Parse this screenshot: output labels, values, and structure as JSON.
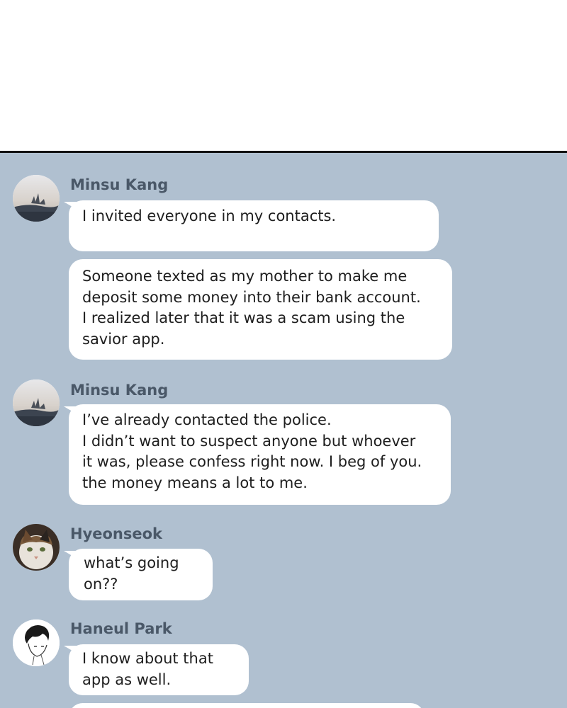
{
  "messages": [
    {
      "sender": "Minsu Kang",
      "avatar_icon": "landscape-avatar-icon",
      "bubbles": [
        "I invited everyone in my contacts.",
        "Someone texted as my mother to make me\ndeposit some money into their bank account.\nI realized later that it was a scam using the\nsavior app."
      ]
    },
    {
      "sender": "Minsu Kang",
      "avatar_icon": "landscape-avatar-icon",
      "bubbles": [
        "I’ve already contacted the police.\nI didn’t want to suspect anyone but whoever\nit was, please confess right now. I beg of you.\nthe money means a lot to me."
      ]
    },
    {
      "sender": "Hyeonseok",
      "avatar_icon": "cat-avatar-icon",
      "bubbles": [
        "what’s going\non??"
      ]
    },
    {
      "sender": "Haneul Park",
      "avatar_icon": "sketch-portrait-avatar-icon",
      "bubbles": [
        "I know about that\napp as well."
      ]
    }
  ],
  "colors": {
    "chat_background": "#b0c0d0",
    "bubble": "#ffffff",
    "sender_name": "#4a5868",
    "message_text": "#1e1e1e"
  }
}
